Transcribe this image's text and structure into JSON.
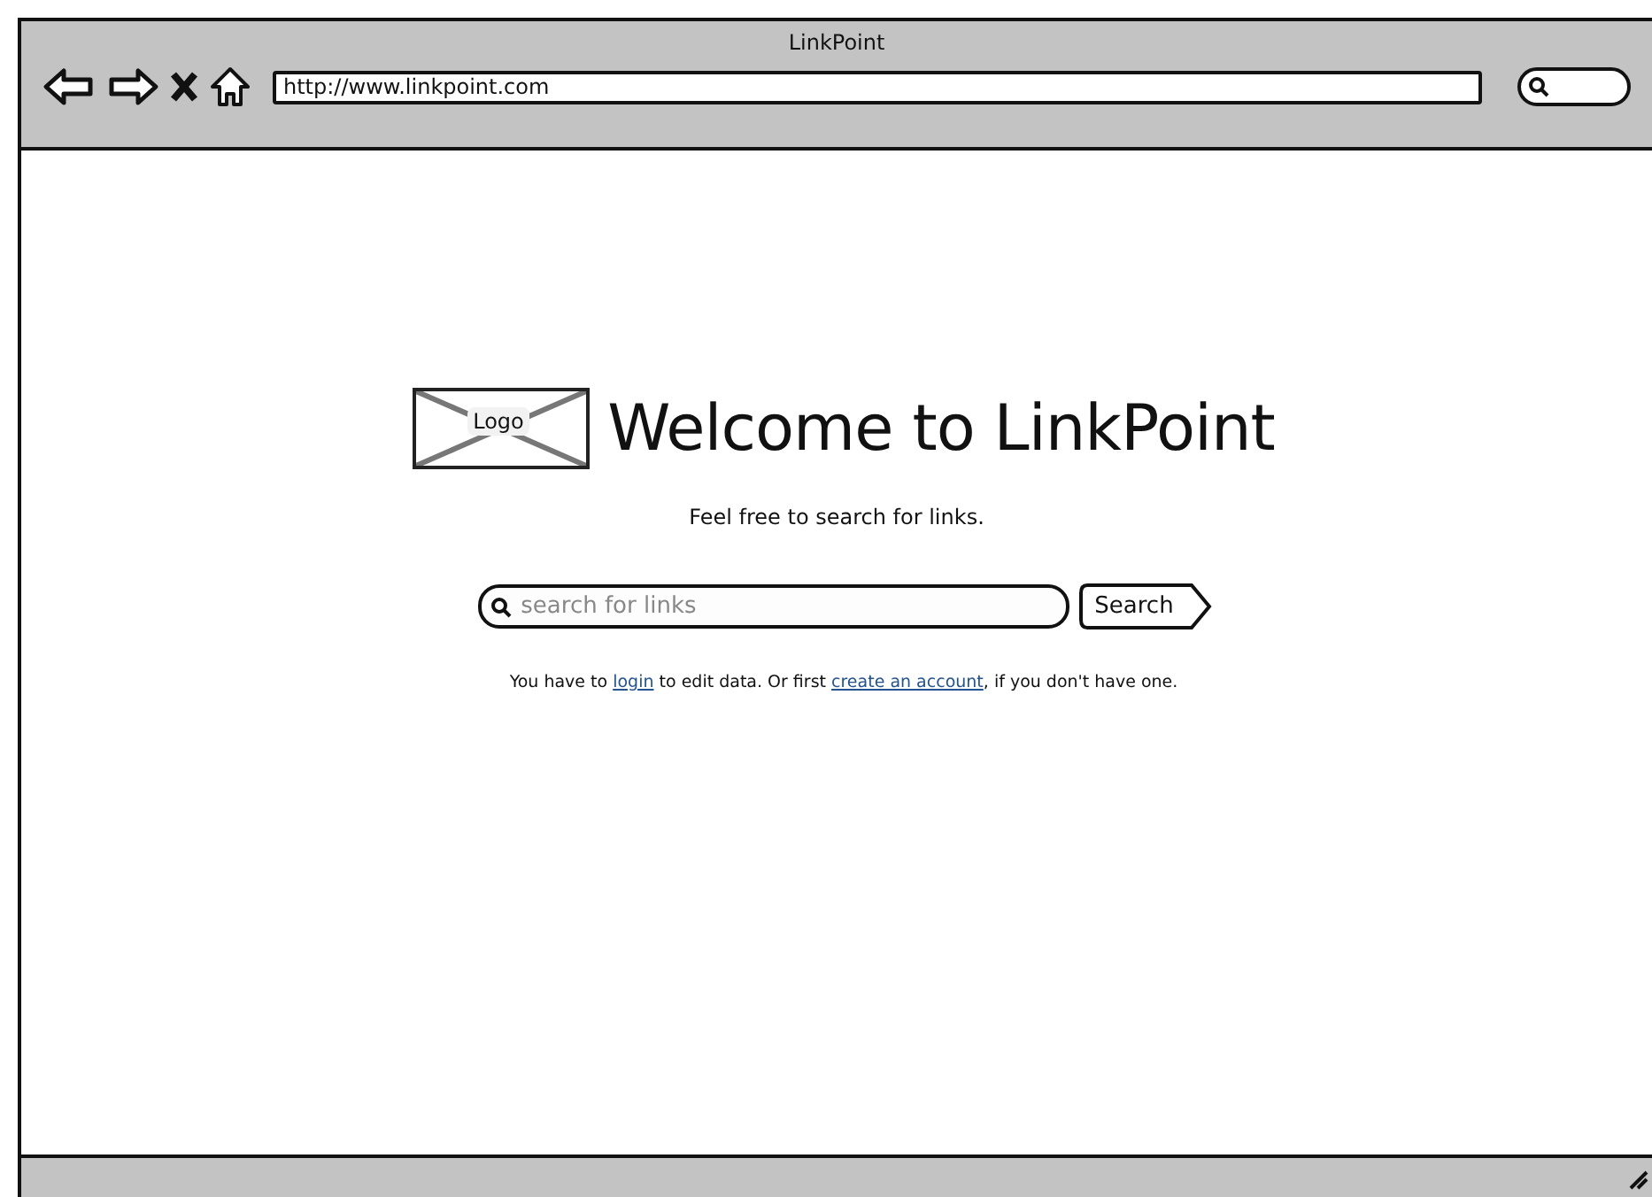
{
  "window": {
    "title": "LinkPoint",
    "address": "http://www.linkpoint.com"
  },
  "logo": {
    "label": "Logo"
  },
  "heading": "Welcome to LinkPoint",
  "subtitle": "Feel free to search for links.",
  "search": {
    "placeholder": "search for links",
    "button": "Search"
  },
  "notice": [
    {
      "kind": "text",
      "text": "You have to "
    },
    {
      "kind": "link",
      "text": "login"
    },
    {
      "kind": "text",
      "text": " to edit data. Or first "
    },
    {
      "kind": "link",
      "text": "create an account"
    },
    {
      "kind": "text",
      "text": ", if you don't have one."
    }
  ]
}
